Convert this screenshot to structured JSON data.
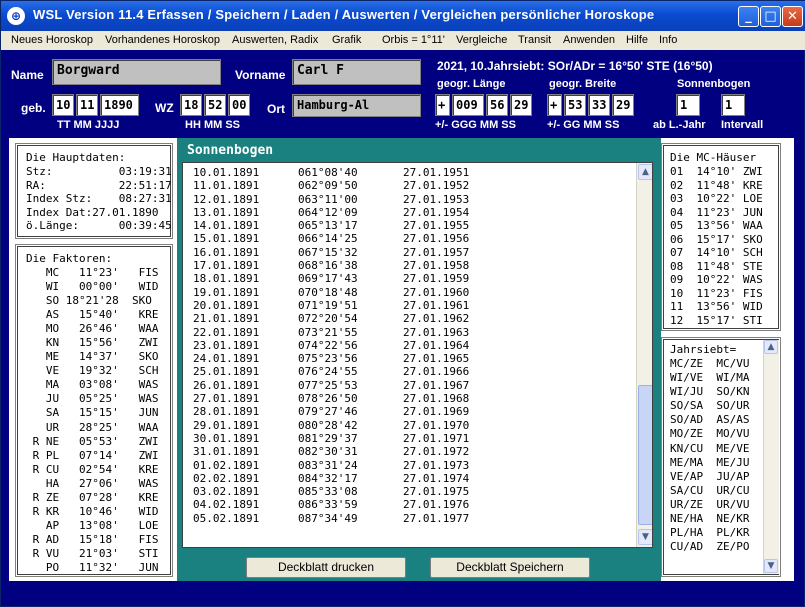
{
  "window": {
    "title": "WSL Version 11.4      Erfassen / Speichern / Laden / Auswerten / Vergleichen persönlicher Horoskope",
    "icon": "app-globe-icon"
  },
  "menu": [
    "Neues Horoskop",
    "Vorhandenes Horoskop",
    "Auswerten, Radix",
    "Grafik",
    "Orbis = 1°11'",
    "Vergleiche",
    "Transit",
    "Anwenden",
    "Hilfe",
    "Info"
  ],
  "person": {
    "name_label": "Name",
    "name": "Borgward",
    "vorname_label": "Vorname",
    "vorname": "Carl F",
    "geb_label": "geb.",
    "day": "10",
    "month": "11",
    "year": "1890",
    "geb_sub": "TT  MM   JJJJ",
    "wz_label": "WZ",
    "hh": "18",
    "mm": "52",
    "ss": "00",
    "wz_sub": "HH  MM  SS",
    "ort_label": "Ort",
    "ort": "Hamburg-Al"
  },
  "info_line": "2021, 10.Jahrsiebt: SOr/ADr = 16°50' STE (16°50)",
  "laenge": {
    "label": "geogr. Länge",
    "sign": "+",
    "deg": "009",
    "min": "56",
    "sec": "29",
    "sub": "+/-  GGG  MM  SS"
  },
  "breite": {
    "label": "geogr. Breite",
    "sign": "+",
    "deg": "53",
    "min": "33",
    "sec": "29",
    "sub": "+/-  GG  MM  SS"
  },
  "sonnenbogen": {
    "label": "Sonnenbogen",
    "from": "1",
    "interval": "1",
    "from_label": "ab L.-Jahr",
    "interval_label": "Intervall"
  },
  "hauptdaten": {
    "title": "Die Hauptdaten:",
    "rows": [
      "Stz:          03:19:31",
      "RA:           22:51:17",
      "Index Stz:    08:27:31",
      "Index Dat:27.01.1890",
      "ö.Länge:      00:39:45"
    ]
  },
  "faktoren": {
    "title": "Die Faktoren:",
    "rows": [
      "   MC   11°23'   FIS",
      "   WI   00°00'   WID",
      "   SO 18°21'28  SKO",
      "   AS   15°40'   KRE",
      "   MO   26°46'   WAA",
      "   KN   15°56'   ZWI",
      "   ME   14°37'   SKO",
      "   VE   19°32'   SCH",
      "   MA   03°08'   WAS",
      "   JU   05°25'   WAS",
      "   SA   15°15'   JUN",
      "   UR   28°25'   WAA",
      " R NE   05°53'   ZWI",
      " R PL   07°14'   ZWI",
      " R CU   02°54'   KRE",
      "   HA   27°06'   WAS",
      " R ZE   07°28'   KRE",
      " R KR   10°46'   WID",
      "   AP   13°08'   LOE",
      " R AD   15°18'   FIS",
      " R VU   21°03'   STI",
      "   PO   11°32'   JUN"
    ]
  },
  "list": {
    "title": "Sonnenbogen",
    "rows": [
      [
        "10.01.1891",
        "061°08'40",
        "27.01.1951"
      ],
      [
        "11.01.1891",
        "062°09'50",
        "27.01.1952"
      ],
      [
        "12.01.1891",
        "063°11'00",
        "27.01.1953"
      ],
      [
        "13.01.1891",
        "064°12'09",
        "27.01.1954"
      ],
      [
        "14.01.1891",
        "065°13'17",
        "27.01.1955"
      ],
      [
        "15.01.1891",
        "066°14'25",
        "27.01.1956"
      ],
      [
        "16.01.1891",
        "067°15'32",
        "27.01.1957"
      ],
      [
        "17.01.1891",
        "068°16'38",
        "27.01.1958"
      ],
      [
        "18.01.1891",
        "069°17'43",
        "27.01.1959"
      ],
      [
        "19.01.1891",
        "070°18'48",
        "27.01.1960"
      ],
      [
        "20.01.1891",
        "071°19'51",
        "27.01.1961"
      ],
      [
        "21.01.1891",
        "072°20'54",
        "27.01.1962"
      ],
      [
        "22.01.1891",
        "073°21'55",
        "27.01.1963"
      ],
      [
        "23.01.1891",
        "074°22'56",
        "27.01.1964"
      ],
      [
        "24.01.1891",
        "075°23'56",
        "27.01.1965"
      ],
      [
        "25.01.1891",
        "076°24'55",
        "27.01.1966"
      ],
      [
        "26.01.1891",
        "077°25'53",
        "27.01.1967"
      ],
      [
        "27.01.1891",
        "078°26'50",
        "27.01.1968"
      ],
      [
        "28.01.1891",
        "079°27'46",
        "27.01.1969"
      ],
      [
        "29.01.1891",
        "080°28'42",
        "27.01.1970"
      ],
      [
        "30.01.1891",
        "081°29'37",
        "27.01.1971"
      ],
      [
        "31.01.1891",
        "082°30'31",
        "27.01.1972"
      ],
      [
        "01.02.1891",
        "083°31'24",
        "27.01.1973"
      ],
      [
        "02.02.1891",
        "084°32'17",
        "27.01.1974"
      ],
      [
        "03.02.1891",
        "085°33'08",
        "27.01.1975"
      ],
      [
        "04.02.1891",
        "086°33'59",
        "27.01.1976"
      ],
      [
        "05.02.1891",
        "087°34'49",
        "27.01.1977"
      ]
    ]
  },
  "mc_haeuser": {
    "title": "Die MC-Häuser",
    "rows": [
      "01  14°10' ZWI",
      "02  11°48' KRE",
      "03  10°22' LOE",
      "04  11°23' JUN",
      "05  13°56' WAA",
      "06  15°17' SKO",
      "07  14°10' SCH",
      "08  11°48' STE",
      "09  10°22' WAS",
      "10  11°23' FIS",
      "11  13°56' WID",
      "12  15°17' STI"
    ]
  },
  "jahrsiebt": {
    "title": "Jahrsiebt=",
    "rows": [
      "MC/ZE  MC/VU",
      "WI/VE  WI/MA",
      "WI/JU  SO/KN",
      "SO/SA  SO/UR",
      "SO/AD  AS/AS",
      "MO/ZE  MO/VU",
      "KN/CU  ME/VE",
      "ME/MA  ME/JU",
      "VE/AP  JU/AP",
      "SA/CU  UR/CU",
      "UR/ZE  UR/VU",
      "NE/HA  NE/KR",
      "PL/HA  PL/KR",
      "CU/AD  ZE/PO"
    ]
  },
  "buttons": {
    "print": "Deckblatt drucken",
    "save": "Deckblatt Speichern"
  },
  "colors": {
    "background": "#000080",
    "panel": "#1a8080",
    "titlebar": "#0a4bd0"
  }
}
